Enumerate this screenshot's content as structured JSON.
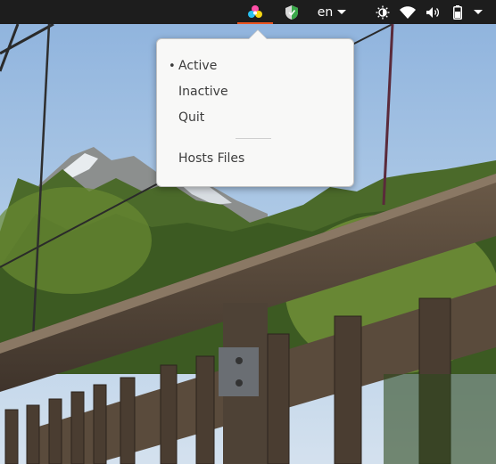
{
  "topbar": {
    "app_indicator_icon": "tricolor-hexagon-icon",
    "shield_icon": "shield-check-icon",
    "language": "en",
    "brightness_icon": "brightness-icon",
    "wifi_icon": "wifi-icon",
    "volume_icon": "volume-icon",
    "battery_icon": "battery-icon",
    "system_menu_icon": "chevron-down-icon"
  },
  "menu": {
    "items": [
      {
        "label": "Active",
        "selected": true,
        "bullet": "•"
      },
      {
        "label": "Inactive",
        "selected": false
      },
      {
        "label": "Quit",
        "selected": false
      },
      {
        "label": "Hosts Files",
        "selected": false
      }
    ]
  },
  "colors": {
    "topbar_bg": "#1d1d1d",
    "indicator_accent": "#e95420",
    "menu_bg": "#f8f8f7",
    "menu_text": "#3c3c3c"
  }
}
